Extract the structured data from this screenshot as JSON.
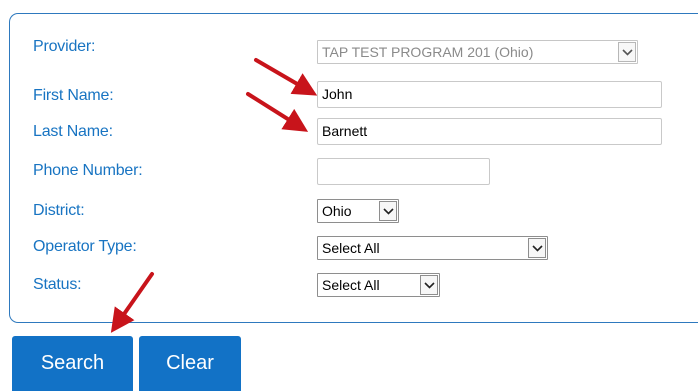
{
  "form": {
    "provider": {
      "label": "Provider:",
      "value": "TAP TEST PROGRAM 201 (Ohio)",
      "disabled": true
    },
    "first_name": {
      "label": "First Name:",
      "value": "John"
    },
    "last_name": {
      "label": "Last Name:",
      "value": "Barnett"
    },
    "phone_number": {
      "label": "Phone Number:",
      "value": ""
    },
    "district": {
      "label": "District:",
      "value": "Ohio"
    },
    "operator_type": {
      "label": "Operator Type:",
      "value": "Select All"
    },
    "status": {
      "label": "Status:",
      "value": "Select All"
    }
  },
  "buttons": {
    "search_label": "Search",
    "clear_label": "Clear"
  },
  "icons": {
    "dropdown": "chevron-down-icon",
    "annotation": "red-arrow"
  },
  "colors": {
    "label_text": "#1874c2",
    "panel_border": "#2e79be",
    "button_bg": "#1272c6",
    "annotation_arrow": "#c8141b"
  }
}
